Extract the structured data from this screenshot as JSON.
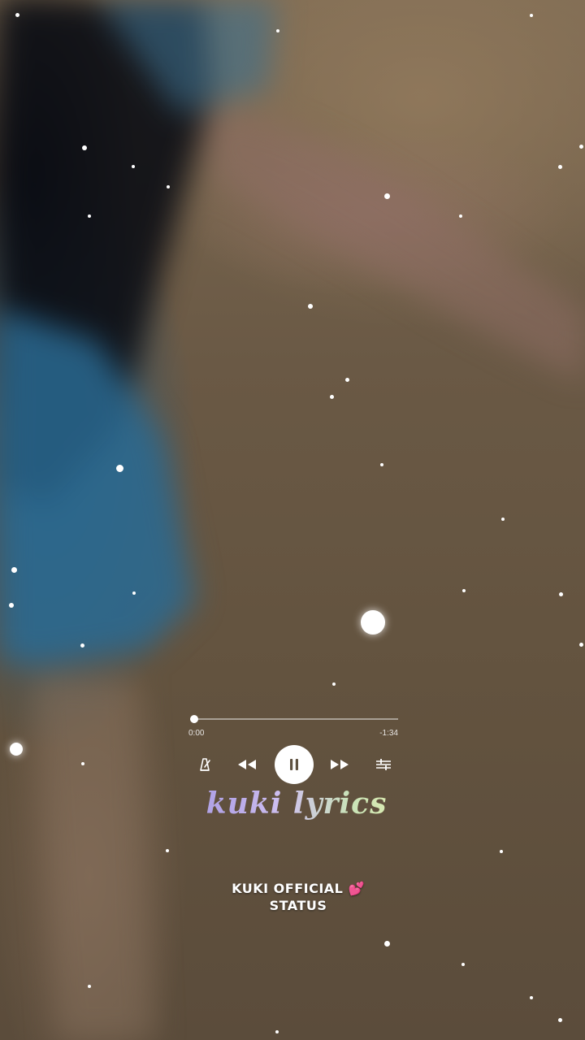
{
  "player": {
    "elapsed": "0:00",
    "remaining": "-1:34",
    "progress": 0.0,
    "state": "playing"
  },
  "icons": {
    "metronome": "metronome-icon",
    "rewind": "rewind-icon",
    "pause": "pause-icon",
    "fast_forward": "fast-forward-icon",
    "equalizer": "equalizer-icon"
  },
  "brand": {
    "title": "kuki  lyrics"
  },
  "watermark": {
    "line1": "KUKI OFFICIAL",
    "line2": "STATUS",
    "emoji": "💕"
  },
  "colors": {
    "accent": "#ffffff",
    "brand_gradient_start": "#a99be0",
    "brand_gradient_end": "#e8f0a8"
  }
}
